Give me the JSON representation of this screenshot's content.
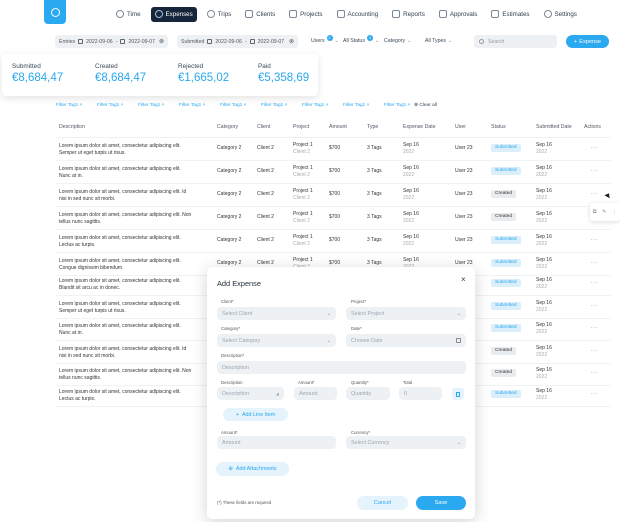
{
  "nav": {
    "items": [
      {
        "label": "Time",
        "icon": "clock-icon"
      },
      {
        "label": "Expenses",
        "icon": "expenses-icon",
        "active": true
      },
      {
        "label": "Trips",
        "icon": "globe-icon"
      },
      {
        "label": "Clients",
        "icon": "clients-icon"
      },
      {
        "label": "Projects",
        "icon": "projects-icon"
      },
      {
        "label": "Accounting",
        "icon": "accounting-icon"
      },
      {
        "label": "Reports",
        "icon": "reports-icon"
      },
      {
        "label": "Approvals",
        "icon": "approvals-icon"
      },
      {
        "label": "Estimates",
        "icon": "estimates-icon"
      },
      {
        "label": "Settings",
        "icon": "gear-icon"
      }
    ]
  },
  "filters": {
    "entries": {
      "label": "Entries",
      "from": "2022-09-06",
      "sep": "-",
      "to": "2022-09-07"
    },
    "submitted": {
      "label": "Submitted",
      "from": "2022-09-06",
      "sep": "-",
      "to": "2022-09-07"
    },
    "users": {
      "label": "Users",
      "badge": "2"
    },
    "status": {
      "label": "All Status",
      "badge": "3"
    },
    "category": {
      "label": "Category"
    },
    "types": {
      "label": "All Types"
    },
    "search_placeholder": "Search",
    "add_label": "Expense"
  },
  "stats": [
    {
      "label": "Submitted",
      "value": "€8,684,47"
    },
    {
      "label": "Created",
      "value": "€8,684,47"
    },
    {
      "label": "Rejected",
      "value": "€1,665,02"
    },
    {
      "label": "Paid",
      "value": "€5,358,69"
    }
  ],
  "tags": [
    "Filter Tag1",
    "Filter Tag1",
    "Filter Tag1",
    "Filter Tag1",
    "Filter Tag1",
    "Filter Tag1",
    "Filter Tag1",
    "Filter Tag1",
    "Filter Tag1"
  ],
  "clear_all": "Clear all",
  "table": {
    "headers": [
      "Description",
      "Category",
      "Client",
      "Project",
      "Amount",
      "Type",
      "Expense Date",
      "User",
      "Status",
      "Submitted Date",
      "Actions"
    ],
    "rows": [
      {
        "desc1": "Lorem ipsum dolor sit amet, consectetur adipiscing elit.",
        "desc2": "Semper ut eget turpis ut risus.",
        "category": "Category 2",
        "client": "Client 2",
        "project": "Project 1",
        "project_sub": "Client 2",
        "amount": "$700",
        "type": "3 Tags",
        "exp_date": "Sep 16",
        "exp_year": "2022",
        "user": "User 23",
        "status": "Submitted",
        "sub_date": "Sep 16",
        "sub_year": "2022",
        "actions": "..."
      },
      {
        "desc1": "Lorem ipsum dolor sit amet, consectetur adipiscing elit.",
        "desc2": "Nunc at in.",
        "category": "Category 2",
        "client": "Client 2",
        "project": "Project 1",
        "project_sub": "Client 2",
        "amount": "$700",
        "type": "3 Tags",
        "exp_date": "Sep 16",
        "exp_year": "2022",
        "user": "User 23",
        "status": "Submitted",
        "sub_date": "Sep 16",
        "sub_year": "2022",
        "actions": "..."
      },
      {
        "desc1": "Lorem ipsum dolor sit amet, consectetur adipiscing elit. Id",
        "desc2": "nisi in sed nunc sit morbi.",
        "category": "Category 2",
        "client": "Client 2",
        "project": "Project 1",
        "project_sub": "Client 2",
        "amount": "$700",
        "type": "3 Tags",
        "exp_date": "Sep 16",
        "exp_year": "2022",
        "user": "User 23",
        "status": "Created",
        "sub_date": "Sep 16",
        "sub_year": "2022",
        "actions": "..."
      },
      {
        "desc1": "Lorem ipsum dolor sit amet, consectetur adipiscing elit. Non",
        "desc2": "tellus nunc sagittis.",
        "category": "Category 2",
        "client": "Client 2",
        "project": "Project 1",
        "project_sub": "Client 2",
        "amount": "$700",
        "type": "3 Tags",
        "exp_date": "Sep 16",
        "exp_year": "2022",
        "user": "User 23",
        "status": "Created",
        "sub_date": "Sep 16",
        "sub_year": "2022",
        "actions": "..."
      },
      {
        "desc1": "Lorem ipsum dolor sit amet, consectetur adipiscing elit.",
        "desc2": "Lectus ac turpis.",
        "category": "Category 2",
        "client": "Client 2",
        "project": "Project 1",
        "project_sub": "Client 2",
        "amount": "$700",
        "type": "3 Tags",
        "exp_date": "Sep 16",
        "exp_year": "2022",
        "user": "User 23",
        "status": "Submitted",
        "sub_date": "Sep 16",
        "sub_year": "2022",
        "actions": "..."
      },
      {
        "desc1": "Lorem ipsum dolor sit amet, consectetur adipiscing elit.",
        "desc2": "Congue dignissim bibendum.",
        "category": "Category 2",
        "client": "Client 2",
        "project": "Project 1",
        "project_sub": "Client 2",
        "amount": "$700",
        "type": "3 Tags",
        "exp_date": "Sep 16",
        "exp_year": "2022",
        "user": "User 23",
        "status": "Submitted",
        "sub_date": "Sep 16",
        "sub_year": "2022",
        "actions": "..."
      },
      {
        "desc1": "Lorem ipsum dolor sit amet, consectetur adipiscing elit.",
        "desc2": "Blandit sit arcu ac in donec.",
        "status": "Submitted",
        "sub_date": "Sep 16",
        "sub_year": "2022",
        "actions": "..."
      },
      {
        "desc1": "Lorem ipsum dolor sit amet, consectetur adipiscing elit.",
        "desc2": "Semper ut eget turpis ut risus.",
        "status": "Submitted",
        "sub_date": "Sep 16",
        "sub_year": "2022",
        "actions": "..."
      },
      {
        "desc1": "Lorem ipsum dolor sit amet, consectetur adipiscing elit.",
        "desc2": "Nunc at in.",
        "status": "Submitted",
        "sub_date": "Sep 16",
        "sub_year": "2022",
        "actions": "..."
      },
      {
        "desc1": "Lorem ipsum dolor sit amet, consectetur adipiscing elit. Id",
        "desc2": "nisi in sed nunc sit morbi.",
        "status": "Created",
        "sub_date": "Sep 16",
        "sub_year": "2022",
        "actions": "..."
      },
      {
        "desc1": "Lorem ipsum dolor sit amet, consectetur adipiscing elit. Non",
        "desc2": "tellus nunc sagittis.",
        "status": "Created",
        "sub_date": "Sep 16",
        "sub_year": "2022",
        "actions": "..."
      },
      {
        "desc1": "Lorem ipsum dolor sit amet, consectetur adipiscing elit.",
        "desc2": "Lectus ac turpis.",
        "status": "Submitted",
        "sub_date": "Sep 16",
        "sub_year": "2022",
        "actions": "..."
      }
    ]
  },
  "modal": {
    "title": "Add Expense",
    "client_label": "Client*",
    "client_placeholder": "Select Client",
    "project_label": "Project*",
    "project_placeholder": "Select Project",
    "category_label": "Category*",
    "category_placeholder": "Select Category",
    "date_label": "Date*",
    "date_placeholder": "Choose Date",
    "description_label": "Description*",
    "description_placeholder": "Description",
    "li_desc_label": "Description",
    "li_desc_placeholder": "Description",
    "li_amount_label": "Amount*",
    "li_amount_placeholder": "Amount",
    "li_qty_label": "Quantity*",
    "li_qty_placeholder": "Quantity",
    "li_total_label": "Total",
    "li_total_value": "0",
    "add_line_item": "Add Line Item",
    "amount_label": "Amount*",
    "amount_placeholder": "Amount",
    "currency_label": "Currency*",
    "currency_placeholder": "Select Currency",
    "add_attachments": "Add Attachments",
    "required_note": "(*) These fields are required",
    "cancel": "Cancel",
    "save": "Save"
  },
  "colors": {
    "accent": "#2aa8f0",
    "nav_active": "#16253a"
  }
}
